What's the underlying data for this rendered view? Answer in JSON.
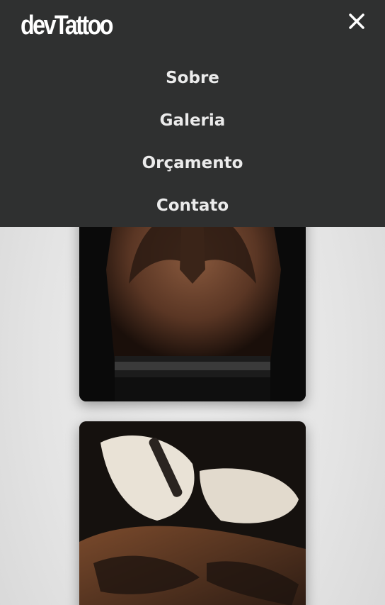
{
  "header": {
    "logo_text": "devTattoo",
    "close_icon": "close-icon"
  },
  "menu": {
    "items": [
      {
        "label": "Sobre"
      },
      {
        "label": "Galeria"
      },
      {
        "label": "Orçamento"
      },
      {
        "label": "Contato"
      }
    ]
  },
  "gallery": {
    "images": [
      {
        "description_icon": "back-wings-tattoo-image"
      },
      {
        "description_icon": "tattooing-arm-image"
      }
    ]
  },
  "colors": {
    "nav_background": "#2f3030",
    "menu_text": "#ebebeb",
    "page_background": "#e4e4e4"
  }
}
